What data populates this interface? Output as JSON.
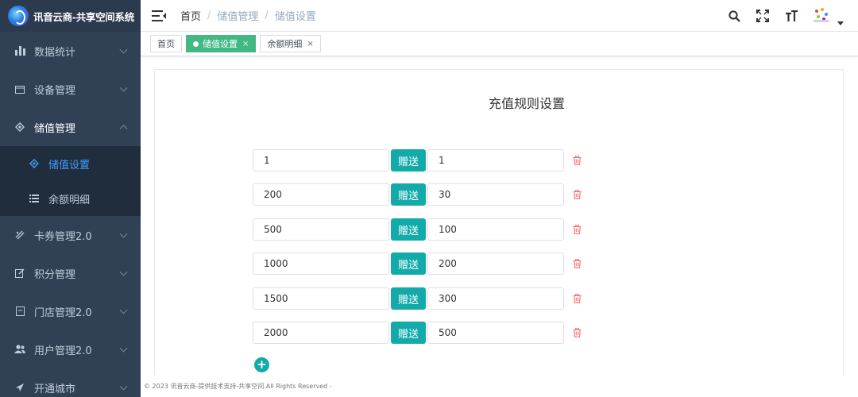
{
  "app": {
    "title": "讯音云商-共享空间系统"
  },
  "sidebar": {
    "items": [
      {
        "label": "数据统计",
        "icon": "bar-chart-icon"
      },
      {
        "label": "设备管理",
        "icon": "device-icon"
      },
      {
        "label": "储值管理",
        "icon": "wallet-icon",
        "expanded": true,
        "children": [
          {
            "label": "储值设置",
            "icon": "setting-icon",
            "active": true
          },
          {
            "label": "余额明细",
            "icon": "list-icon"
          }
        ]
      },
      {
        "label": "卡券管理2.0",
        "icon": "coupon-icon"
      },
      {
        "label": "积分管理",
        "icon": "edit-icon"
      },
      {
        "label": "门店管理2.0",
        "icon": "store-icon"
      },
      {
        "label": "用户管理2.0",
        "icon": "users-icon"
      },
      {
        "label": "开通城市",
        "icon": "location-icon"
      }
    ]
  },
  "breadcrumb": {
    "home": "首页",
    "section": "储值管理",
    "page": "储值设置"
  },
  "tabs": [
    {
      "label": "首页",
      "active": false,
      "closable": false
    },
    {
      "label": "储值设置",
      "active": true,
      "closable": true
    },
    {
      "label": "余额明细",
      "active": false,
      "closable": true
    }
  ],
  "panel": {
    "title": "充值规则设置",
    "give_label": "赠送",
    "rules": [
      {
        "amount": "1",
        "bonus": "1"
      },
      {
        "amount": "200",
        "bonus": "30"
      },
      {
        "amount": "500",
        "bonus": "100"
      },
      {
        "amount": "1000",
        "bonus": "200"
      },
      {
        "amount": "1500",
        "bonus": "300"
      },
      {
        "amount": "2000",
        "bonus": "500"
      }
    ],
    "add_symbol": "+"
  },
  "footer": {
    "text": "© 2023 讯音云商-提供技术支持-共享空间 All Rights Reserved -"
  },
  "colors": {
    "sidebar_bg": "#304156",
    "active_link": "#409eff",
    "tag_active": "#42b983",
    "teal": "#13abaa",
    "delete": "#f56c6c"
  }
}
